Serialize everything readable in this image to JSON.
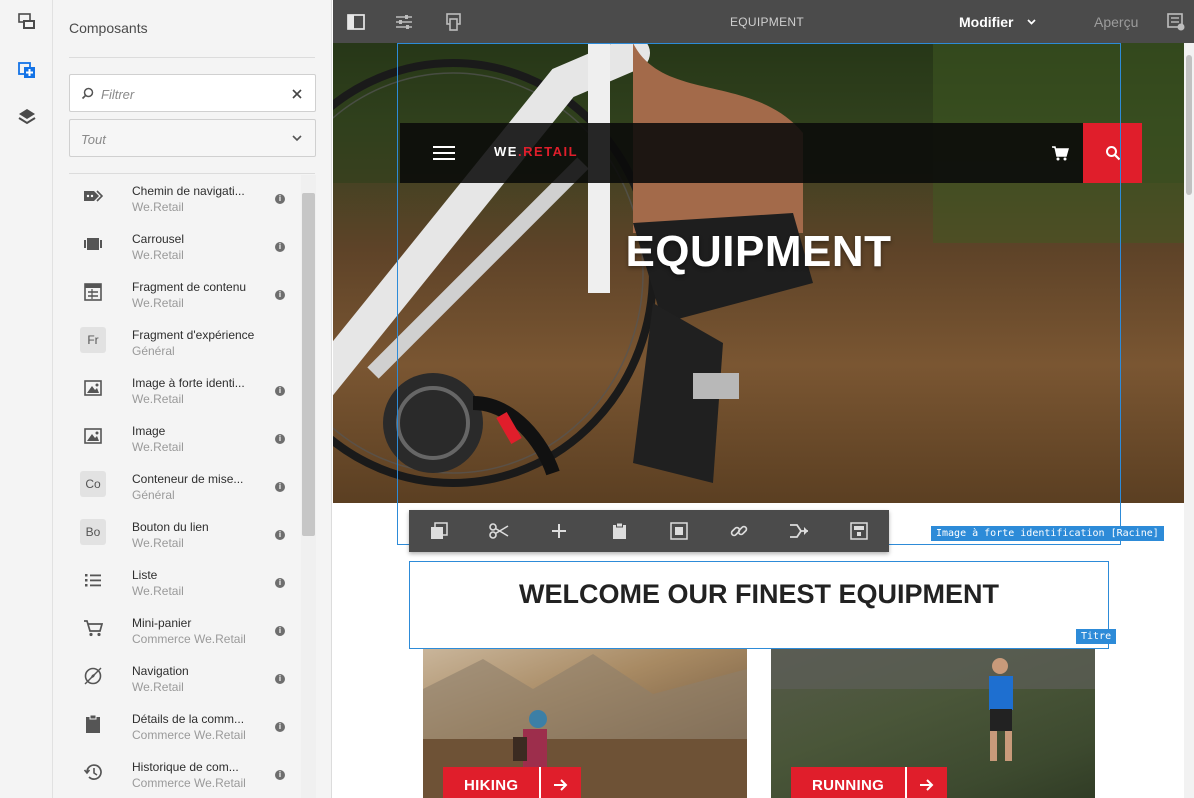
{
  "app": {
    "page_title": "EQUIPMENT",
    "mode_label": "Modifier",
    "preview_label": "Aperçu"
  },
  "panel": {
    "title": "Composants",
    "filter_placeholder": "Filtrer",
    "group_select_value": "Tout",
    "components": [
      {
        "name": "Chemin de navigati...",
        "group": "We.Retail",
        "icon": "breadcrumb-icon"
      },
      {
        "name": "Carrousel",
        "group": "We.Retail",
        "icon": "carousel-icon"
      },
      {
        "name": "Fragment de contenu",
        "group": "We.Retail",
        "icon": "content-fragment-icon"
      },
      {
        "name": "Fragment d'expérience",
        "group": "Général",
        "abbr": "Fr"
      },
      {
        "name": "Image à forte identi...",
        "group": "We.Retail",
        "icon": "image-icon"
      },
      {
        "name": "Image",
        "group": "We.Retail",
        "icon": "image-icon"
      },
      {
        "name": "Conteneur de mise...",
        "group": "Général",
        "abbr": "Co"
      },
      {
        "name": "Bouton du lien",
        "group": "We.Retail",
        "abbr": "Bo"
      },
      {
        "name": "Liste",
        "group": "We.Retail",
        "icon": "list-icon"
      },
      {
        "name": "Mini-panier",
        "group": "Commerce We.Retail",
        "icon": "cart-icon"
      },
      {
        "name": "Navigation",
        "group": "We.Retail",
        "icon": "compass-icon"
      },
      {
        "name": "Détails de la comm...",
        "group": "Commerce We.Retail",
        "icon": "clipboard-icon"
      },
      {
        "name": "Historique de com...",
        "group": "Commerce We.Retail",
        "icon": "history-icon"
      }
    ]
  },
  "site": {
    "logo_prefix": "WE",
    "logo_dot": ".",
    "logo_suffix": "RETAIL",
    "hero_title": "EQUIPMENT",
    "section_title": "WELCOME OUR FINEST EQUIPMENT",
    "cards": [
      {
        "label": "HIKING"
      },
      {
        "label": "RUNNING"
      }
    ]
  },
  "editor": {
    "hero_component_tag": "Image à forte identification [Racine]",
    "title_component_tag": "Titre"
  },
  "colors": {
    "accent_red": "#e01e2b",
    "selection_blue": "#2d8bd8",
    "topbar_bg": "#4b4b4b"
  }
}
